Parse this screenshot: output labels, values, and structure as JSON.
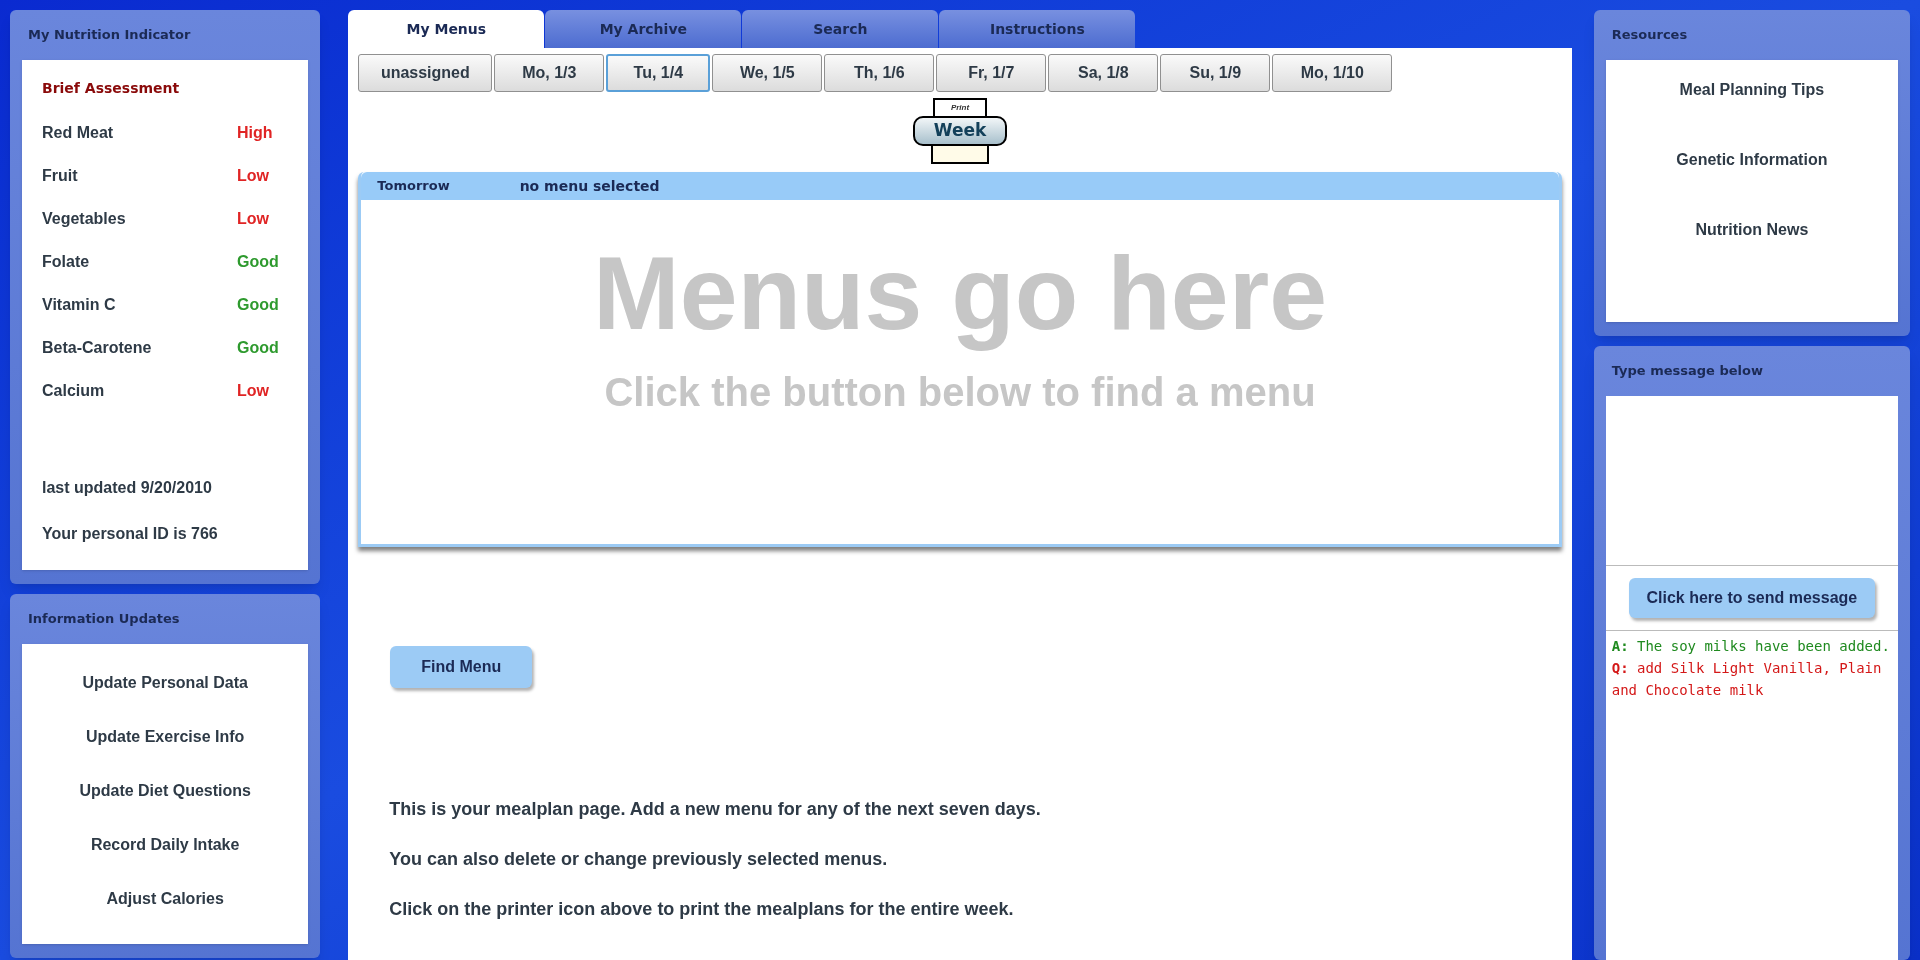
{
  "nutrition_indicator": {
    "title": "My Nutrition Indicator",
    "assessment_title": "Brief Assessment",
    "items": [
      {
        "name": "Red Meat",
        "rating": "High",
        "color": "#e02424"
      },
      {
        "name": "Fruit",
        "rating": "Low",
        "color": "#e02424"
      },
      {
        "name": "Vegetables",
        "rating": "Low",
        "color": "#e02424"
      },
      {
        "name": "Folate",
        "rating": "Good",
        "color": "#2e9a2e"
      },
      {
        "name": "Vitamin C",
        "rating": "Good",
        "color": "#2e9a2e"
      },
      {
        "name": "Beta-Carotene",
        "rating": "Good",
        "color": "#2e9a2e"
      },
      {
        "name": "Calcium",
        "rating": "Low",
        "color": "#e02424"
      }
    ],
    "last_updated": "last updated 9/20/2010",
    "personal_id": "Your personal ID is 766"
  },
  "information_updates": {
    "title": "Information Updates",
    "links": [
      "Update Personal Data",
      "Update Exercise Info",
      "Update Diet Questions",
      "Record Daily Intake",
      "Adjust Calories"
    ]
  },
  "tabs": [
    {
      "label": "My Menus",
      "selected": true
    },
    {
      "label": "My Archive",
      "selected": false
    },
    {
      "label": "Search",
      "selected": false
    },
    {
      "label": "Instructions",
      "selected": false
    }
  ],
  "days": [
    {
      "label": "unassigned",
      "selected": false
    },
    {
      "label": "Mo, 1/3",
      "selected": false
    },
    {
      "label": "Tu, 1/4",
      "selected": true
    },
    {
      "label": "We, 1/5",
      "selected": false
    },
    {
      "label": "Th, 1/6",
      "selected": false
    },
    {
      "label": "Fr, 1/7",
      "selected": false
    },
    {
      "label": "Sa, 1/8",
      "selected": false
    },
    {
      "label": "Su, 1/9",
      "selected": false
    },
    {
      "label": "Mo, 1/10",
      "selected": false
    }
  ],
  "print_button": {
    "paper_label": "Print",
    "label": "Week"
  },
  "menu_panel": {
    "day": "Tomorrow",
    "status": "no menu selected",
    "placeholder_title": "Menus go here",
    "placeholder_subtitle": "Click the button below to find a menu"
  },
  "find_menu_button": "Find Menu",
  "instructions": [
    "This is your mealplan page. Add a new menu for any of the next seven days.",
    "You can also delete or change previously selected menus.",
    "Click on the printer icon above to print the mealplans for the entire week."
  ],
  "resources": {
    "title": "Resources",
    "links": [
      "Meal Planning Tips",
      "Genetic Information",
      "Nutrition News"
    ]
  },
  "messages": {
    "title": "Type message below",
    "send_button": "Click here to send message",
    "items": [
      {
        "kind": "answer",
        "prefix": "A:",
        "text": "The soy milks have been added."
      },
      {
        "kind": "question",
        "prefix": "Q:",
        "text": "add Silk Light Vanilla, Plain and Chocolate milk"
      }
    ]
  }
}
